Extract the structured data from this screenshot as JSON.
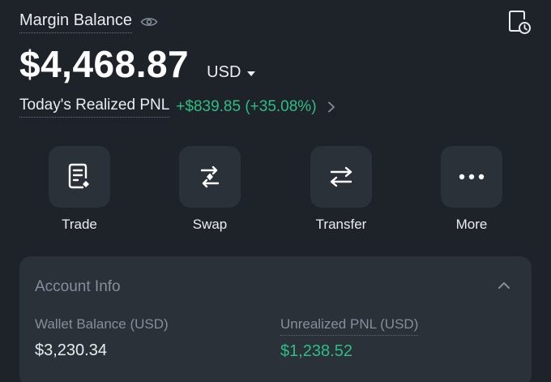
{
  "header": {
    "title": "Margin Balance",
    "balance": "$4,468.87",
    "currency": "USD"
  },
  "pnl": {
    "label": "Today's Realized PNL",
    "value": "+$839.85 (+35.08%)"
  },
  "actions": [
    {
      "label": "Trade",
      "icon": "order-document-icon"
    },
    {
      "label": "Swap",
      "icon": "swap-icon"
    },
    {
      "label": "Transfer",
      "icon": "transfer-arrows-icon"
    },
    {
      "label": "More",
      "icon": "more-dots-icon"
    }
  ],
  "account_info": {
    "title": "Account Info",
    "wallet_balance_label": "Wallet Balance (USD)",
    "wallet_balance_value": "$3,230.34",
    "unrealized_pnl_label": "Unrealized PNL (USD)",
    "unrealized_pnl_value": "$1,238.52"
  },
  "colors": {
    "background": "#1e2329",
    "tile": "#2b3139",
    "positive": "#2ebd85",
    "muted": "#848e9c"
  }
}
